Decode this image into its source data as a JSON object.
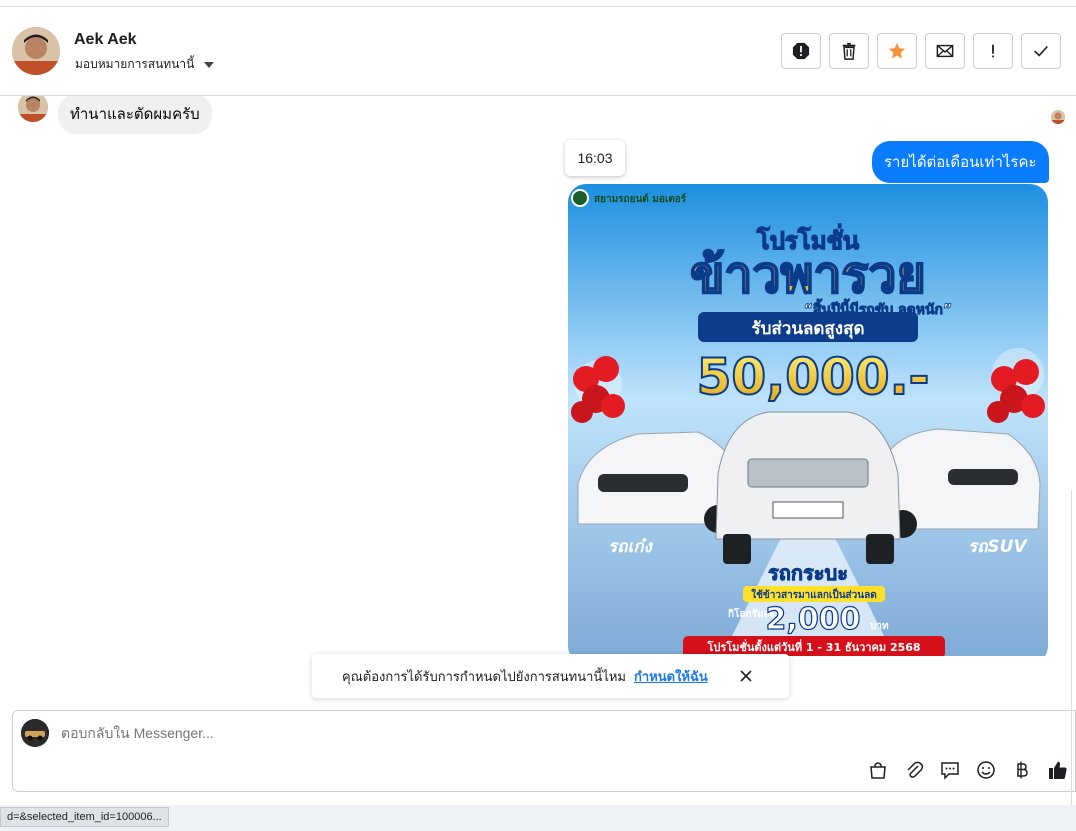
{
  "header": {
    "contact_name": "Aek Aek",
    "assign_label": "มอบหมายการสนทนานี้",
    "actions": [
      {
        "name": "spam-button",
        "icon": "exclamation-octagon-icon"
      },
      {
        "name": "delete-button",
        "icon": "trash-icon"
      },
      {
        "name": "star-button",
        "icon": "star-icon"
      },
      {
        "name": "mark-unread-button",
        "icon": "envelope-icon"
      },
      {
        "name": "follow-up-button",
        "icon": "exclamation-icon"
      },
      {
        "name": "mark-done-button",
        "icon": "check-icon"
      }
    ],
    "star_color": "#f7923b"
  },
  "messages": {
    "incoming_text": "ทำนาและตัดผมครับ",
    "timestamp": "16:03",
    "outgoing_text": "รายได้ต่อเดือนเท่าไรคะ",
    "outgoing_color": "#0a7cff"
  },
  "promo": {
    "brand": "สยามรถยนต์ มอเตอร์",
    "headline_top": "โปรโมชั่น",
    "headline_main": "ข้าวพารวย",
    "tagline": "“สิ้นปีนี้มีรถขับ ลดหนัก”",
    "discount_label": "รับส่วนลดสูงสุด",
    "discount_amount": "50,000.-",
    "car_left_label": "รถเก๋ง",
    "car_right_label": "รถSUV",
    "car_center_label": "รถกระบะ",
    "rice_exchange": "ใช้ข้าวสารมาแลกเป็นส่วนลด",
    "per_kg_label": "กิโลกรัมละ",
    "per_kg_amount": "2,000",
    "per_kg_unit": "บาท",
    "period": "โปรโมชั่นตั้งแต่วันที่ 1 - 31 ธันวาคม 2568"
  },
  "notice": {
    "text": "คุณต้องการได้รับการกำหนดไปยังการสนทนานี้ไหม",
    "link": "กำหนดให้ฉัน"
  },
  "composer": {
    "placeholder": "ตอบกลับใน Messenger...",
    "tools": [
      "bag-icon",
      "paperclip-icon",
      "chat-bubble-icon",
      "emoji-icon",
      "baht-icon",
      "thumbs-up-icon"
    ]
  },
  "status_url": "d=&selected_item_id=100006..."
}
